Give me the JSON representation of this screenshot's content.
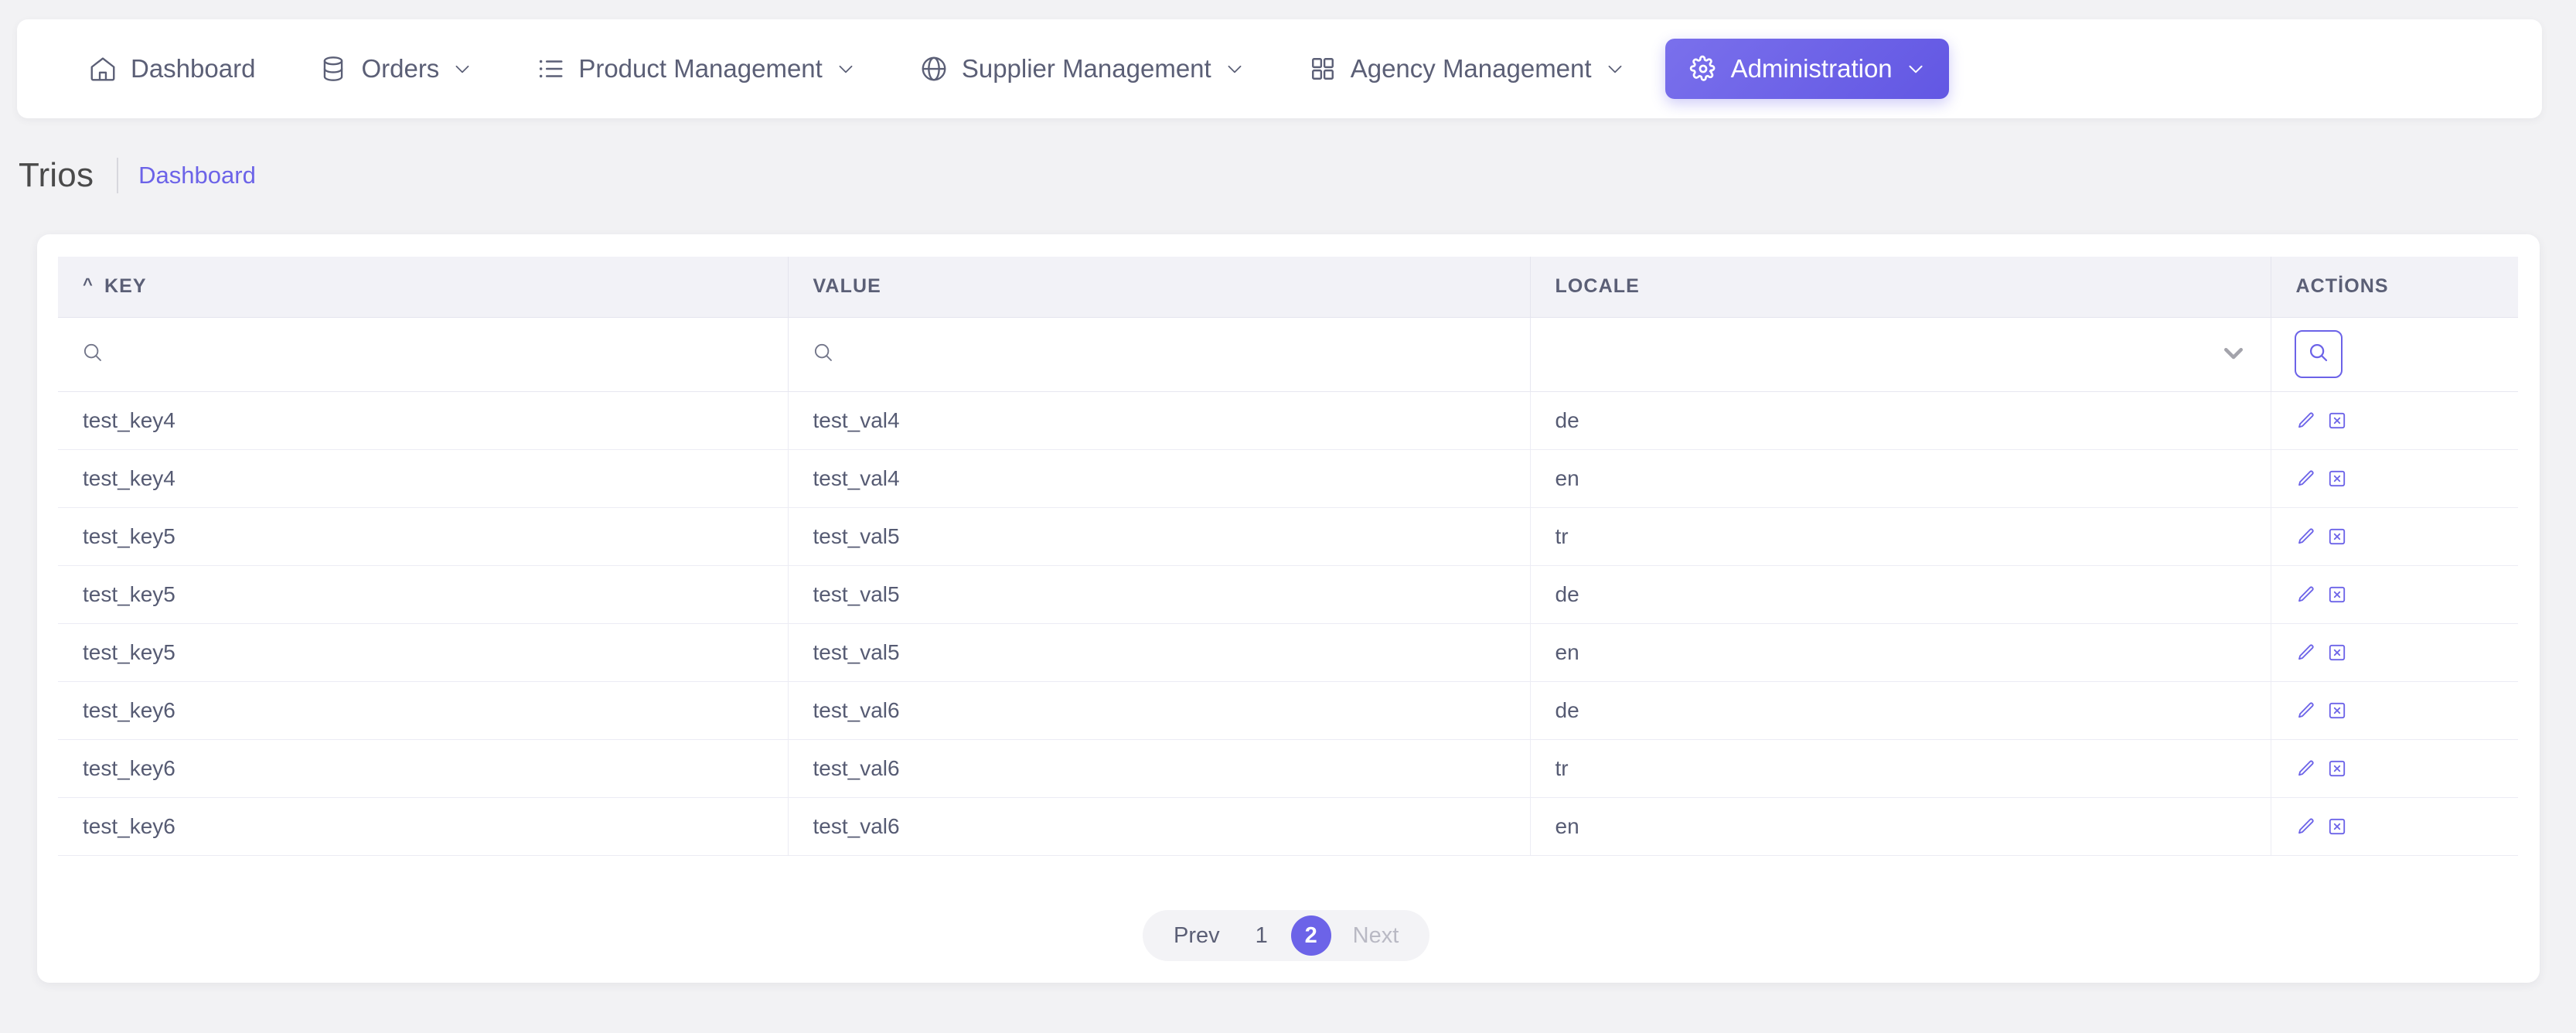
{
  "navbar": {
    "items": [
      {
        "label": "Dashboard",
        "icon": "home-icon",
        "caret": false,
        "active": false
      },
      {
        "label": "Orders",
        "icon": "database-icon",
        "caret": true,
        "active": false
      },
      {
        "label": "Product Management",
        "icon": "list-icon",
        "caret": true,
        "active": false
      },
      {
        "label": "Supplier Management",
        "icon": "globe-icon",
        "caret": true,
        "active": false
      },
      {
        "label": "Agency Management",
        "icon": "grid-icon",
        "caret": true,
        "active": false
      },
      {
        "label": "Administration",
        "icon": "gear-icon",
        "caret": true,
        "active": true
      }
    ]
  },
  "page": {
    "title": "Trios",
    "breadcrumb": "Dashboard"
  },
  "table": {
    "columns": [
      {
        "label": "KEY",
        "sort": "asc"
      },
      {
        "label": "VALUE",
        "sort": null
      },
      {
        "label": "LOCALE",
        "sort": null
      },
      {
        "label": "ACTİONS",
        "sort": null
      }
    ],
    "filters": {
      "key_placeholder": "",
      "key_value": "",
      "value_placeholder": "",
      "value_value": "",
      "locale_selected": "",
      "search_button_icon": "search-icon"
    },
    "row_actions": [
      {
        "icon": "edit-pencil-icon",
        "label": "Edit"
      },
      {
        "icon": "delete-x-icon",
        "label": "Delete"
      }
    ],
    "rows": [
      {
        "key": "test_key4",
        "value": "test_val4",
        "locale": "de"
      },
      {
        "key": "test_key4",
        "value": "test_val4",
        "locale": "en"
      },
      {
        "key": "test_key5",
        "value": "test_val5",
        "locale": "tr"
      },
      {
        "key": "test_key5",
        "value": "test_val5",
        "locale": "de"
      },
      {
        "key": "test_key5",
        "value": "test_val5",
        "locale": "en"
      },
      {
        "key": "test_key6",
        "value": "test_val6",
        "locale": "de"
      },
      {
        "key": "test_key6",
        "value": "test_val6",
        "locale": "tr"
      },
      {
        "key": "test_key6",
        "value": "test_val6",
        "locale": "en"
      }
    ]
  },
  "pagination": {
    "prev_label": "Prev",
    "next_label": "Next",
    "pages": [
      "1",
      "2"
    ],
    "current": "2",
    "prev_disabled": false,
    "next_disabled": true
  },
  "colors": {
    "accent": "#6c63e8",
    "accent_dark": "#6257e3",
    "page_bg": "#f2f2f4",
    "card_bg": "#ffffff",
    "header_bg": "#f2f2f7",
    "text": "#565b73",
    "muted": "#b9b9c4"
  }
}
